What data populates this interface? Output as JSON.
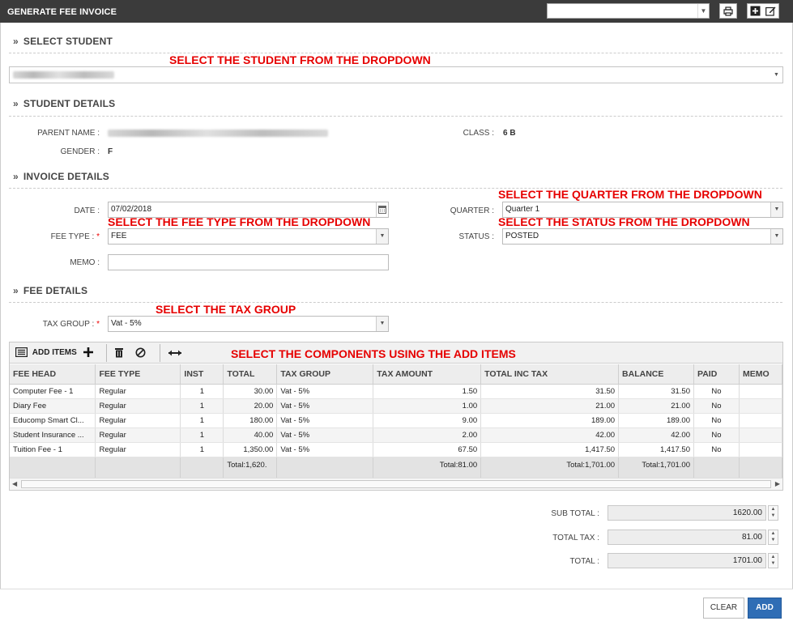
{
  "window": {
    "title": "GENERATE FEE INVOICE",
    "print_icon": "printer-icon",
    "add_icon": "add-box-icon",
    "edit_icon": "edit-icon"
  },
  "sections": {
    "select_student": "SELECT STUDENT",
    "student_details": "STUDENT DETAILS",
    "invoice_details": "INVOICE DETAILS",
    "fee_details": "FEE DETAILS"
  },
  "annotations": {
    "student": "SELECT THE STUDENT FROM THE DROPDOWN",
    "quarter": "SELECT THE QUARTER FROM THE DROPDOWN",
    "fee_type": "SELECT THE FEE TYPE FROM THE DROPDOWN",
    "status": "SELECT THE STATUS FROM THE DROPDOWN",
    "tax_group": "SELECT THE TAX GROUP",
    "components": "SELECT THE COMPONENTS USING THE ADD ITEMS"
  },
  "student_details": {
    "parent_label": "PARENT NAME :",
    "class_label": "CLASS :",
    "class_value": "6 B",
    "gender_label": "GENDER :",
    "gender_value": "F"
  },
  "invoice": {
    "date_label": "DATE :",
    "date_value": "07/02/2018",
    "fee_type_label": "FEE TYPE :",
    "fee_type_value": "FEE",
    "memo_label": "MEMO :",
    "memo_value": "",
    "quarter_label": "QUARTER :",
    "quarter_value": "Quarter 1",
    "status_label": "STATUS :",
    "status_value": "POSTED",
    "required_mark": "*"
  },
  "fee_details": {
    "tax_group_label": "TAX GROUP :",
    "tax_group_value": "Vat - 5%"
  },
  "toolbar": {
    "add_items_label": "ADD ITEMS"
  },
  "grid": {
    "columns": [
      "FEE HEAD",
      "FEE TYPE",
      "INST",
      "TOTAL",
      "TAX GROUP",
      "TAX AMOUNT",
      "TOTAL INC TAX",
      "BALANCE",
      "PAID",
      "MEMO"
    ],
    "rows": [
      [
        "Computer Fee - 1",
        "Regular",
        "1",
        "30.00",
        "Vat - 5%",
        "1.50",
        "31.50",
        "31.50",
        "No",
        ""
      ],
      [
        "Diary Fee",
        "Regular",
        "1",
        "20.00",
        "Vat - 5%",
        "1.00",
        "21.00",
        "21.00",
        "No",
        ""
      ],
      [
        "Educomp Smart Cl...",
        "Regular",
        "1",
        "180.00",
        "Vat - 5%",
        "9.00",
        "189.00",
        "189.00",
        "No",
        ""
      ],
      [
        "Student Insurance ...",
        "Regular",
        "1",
        "40.00",
        "Vat - 5%",
        "2.00",
        "42.00",
        "42.00",
        "No",
        ""
      ],
      [
        "Tuition Fee - 1",
        "Regular",
        "1",
        "1,350.00",
        "Vat - 5%",
        "67.50",
        "1,417.50",
        "1,417.50",
        "No",
        ""
      ]
    ],
    "footer": {
      "total": "Total:1,620.",
      "tax_amount": "Total:81.00",
      "total_inc_tax": "Total:1,701.00",
      "balance": "Total:1,701.00"
    }
  },
  "totals": {
    "sub_total_label": "SUB TOTAL :",
    "sub_total_value": "1620.00",
    "total_tax_label": "TOTAL TAX :",
    "total_tax_value": "81.00",
    "total_label": "TOTAL :",
    "total_value": "1701.00"
  },
  "buttons": {
    "clear": "CLEAR",
    "add": "ADD"
  }
}
